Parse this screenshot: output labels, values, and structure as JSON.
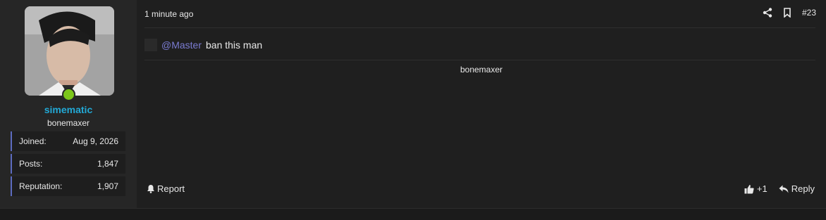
{
  "author": {
    "username": "simematic",
    "user_title": "bonemaxer",
    "stats": [
      {
        "label": "Joined:",
        "value": "Aug 9, 2026"
      },
      {
        "label": "Posts:",
        "value": "1,847"
      },
      {
        "label": "Reputation:",
        "value": "1,907"
      }
    ],
    "status_color": "#7cc61a"
  },
  "post": {
    "time": "1 minute ago",
    "number": "#23",
    "mention": "@Master",
    "text": "ban this man",
    "signature": "bonemaxer"
  },
  "actions": {
    "report": "Report",
    "reaction": "+1",
    "reply": "Reply"
  },
  "colors": {
    "username": "#22a9d6",
    "mention": "#7a7bd1",
    "stat_accent": "#5c6bc0"
  },
  "icons": [
    "share-icon",
    "bookmark-icon",
    "bell-icon",
    "thumbs-up-icon",
    "reply-icon"
  ]
}
